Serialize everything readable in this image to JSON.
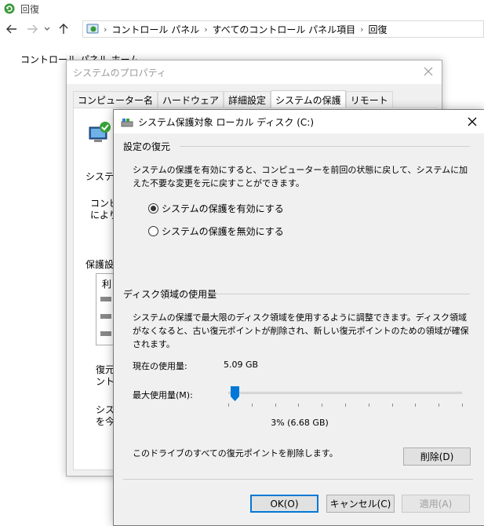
{
  "explorer": {
    "title": "回復",
    "breadcrumb": [
      "コントロール パネル",
      "すべてのコントロール パネル項目",
      "回復"
    ],
    "home_link_text": "コントロール パネル ホーム"
  },
  "system_properties": {
    "title": "システムのプロパティ",
    "tabs": [
      "コンピューター名",
      "ハードウェア",
      "詳細設定",
      "システムの保護",
      "リモート"
    ],
    "active_tab": "システムの保護",
    "fragments": {
      "frag1": "システム",
      "frag2": "コンピュ",
      "frag3": "により、",
      "frag4": "保護設",
      "frag5": "利",
      "frag6": "復元",
      "frag7": "ントを",
      "frag8": "システ",
      "frag9": "を今"
    }
  },
  "dialog": {
    "title": "システム保護対象 ローカル ディスク (C:)",
    "restore_settings": {
      "heading": "設定の復元",
      "description": "システムの保護を有効にすると、コンピューターを前回の状態に戻して、システムに加えた不要な変更を元に戻すことができます。",
      "options": [
        {
          "label": "システムの保護を有効にする",
          "selected": true
        },
        {
          "label": "システムの保護を無効にする",
          "selected": false
        }
      ]
    },
    "disk_usage": {
      "heading": "ディスク領域の使用量",
      "description": "システムの保護で最大限のディスク領域を使用するように調整できます。ディスク領域がなくなると、古い復元ポイントが削除され、新しい復元ポイントのための領域が確保されます。",
      "current_usage_label": "現在の使用量:",
      "current_usage_value": "5.09 GB",
      "max_usage_label": "最大使用量(M):",
      "max_usage_percent": 3,
      "max_usage_display": "3% (6.68 GB)",
      "delete_text": "このドライブのすべての復元ポイントを削除します。",
      "delete_button": "削除(D)"
    },
    "buttons": {
      "ok": "OK(O)",
      "cancel": "キャンセル(C)",
      "apply": "適用(A)"
    }
  },
  "colors": {
    "accent": "#0078d7",
    "window_bg": "#f0f0f0"
  }
}
